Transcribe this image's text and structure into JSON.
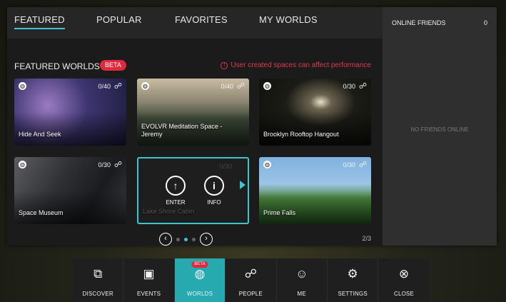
{
  "nav": {
    "tabs": [
      {
        "label": "FEATURED",
        "active": true
      },
      {
        "label": "POPULAR"
      },
      {
        "label": "FAVORITES"
      },
      {
        "label": "MY WORLDS"
      }
    ]
  },
  "section": {
    "title": "FEATURED WORLDS",
    "beta": "BETA",
    "warning": "User created spaces can affect performance",
    "warning_icon": "!"
  },
  "worlds": [
    {
      "title": "Hide And Seek",
      "count": "0/40"
    },
    {
      "title": "EVOLVR Meditation Space - Jeremy",
      "count": "0/40"
    },
    {
      "title": "Brooklyn Rooftop Hangout",
      "count": "0/30"
    },
    {
      "title": "Space Museum",
      "count": "0/30"
    },
    {
      "title": "Lake Shore Cabin",
      "count": "0/30",
      "selected": true
    },
    {
      "title": "Prime Falls",
      "count": "0/30"
    }
  ],
  "card_actions": {
    "enter": "ENTER",
    "info": "INFO"
  },
  "pager": {
    "page": "2/3"
  },
  "friends": {
    "title": "ONLINE FRIENDS",
    "count": "0",
    "empty": "NO FRIENDS ONLINE"
  },
  "dock": {
    "beta": "BETA",
    "items": [
      {
        "label": "DISCOVER"
      },
      {
        "label": "EVENTS"
      },
      {
        "label": "WORLDS",
        "active": true
      },
      {
        "label": "PEOPLE"
      },
      {
        "label": "ME"
      },
      {
        "label": "SETTINGS"
      },
      {
        "label": "CLOSE"
      }
    ]
  },
  "colors": {
    "accent": "#3cc6cf",
    "active_tab_bg": "#27a9b0",
    "beta": "#e0293e",
    "warning": "#e0394a"
  }
}
